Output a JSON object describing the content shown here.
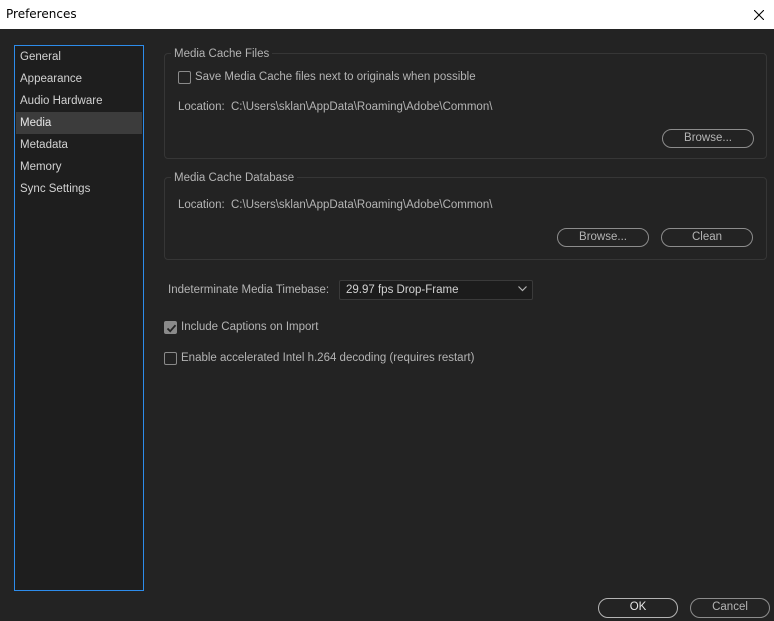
{
  "window": {
    "title": "Preferences"
  },
  "sidebar": {
    "items": [
      {
        "label": "General"
      },
      {
        "label": "Appearance"
      },
      {
        "label": "Audio Hardware"
      },
      {
        "label": "Media",
        "active": true
      },
      {
        "label": "Metadata"
      },
      {
        "label": "Memory"
      },
      {
        "label": "Sync Settings"
      }
    ]
  },
  "media_cache_files": {
    "title": "Media Cache Files",
    "save_next_to_originals_label": "Save Media Cache files next to originals when possible",
    "save_next_to_originals_checked": false,
    "location_label": "Location:",
    "location_path": "C:\\Users\\sklan\\AppData\\Roaming\\Adobe\\Common\\",
    "browse_label": "Browse..."
  },
  "media_cache_database": {
    "title": "Media Cache Database",
    "location_label": "Location:",
    "location_path": "C:\\Users\\sklan\\AppData\\Roaming\\Adobe\\Common\\",
    "browse_label": "Browse...",
    "clean_label": "Clean"
  },
  "timebase": {
    "label": "Indeterminate Media Timebase:",
    "selected": "29.97 fps Drop-Frame"
  },
  "options": {
    "include_captions_label": "Include Captions on Import",
    "include_captions_checked": true,
    "accelerated_decoding_label": "Enable accelerated Intel h.264 decoding (requires restart)",
    "accelerated_decoding_checked": false
  },
  "footer": {
    "ok_label": "OK",
    "cancel_label": "Cancel"
  },
  "colors": {
    "background": "#232323",
    "sidebar_border": "#2d8ceb",
    "active_item": "#3c3c3c"
  },
  "icons": {
    "close": "close-icon",
    "dropdown": "chevron-down-icon",
    "check": "checkmark-icon"
  }
}
